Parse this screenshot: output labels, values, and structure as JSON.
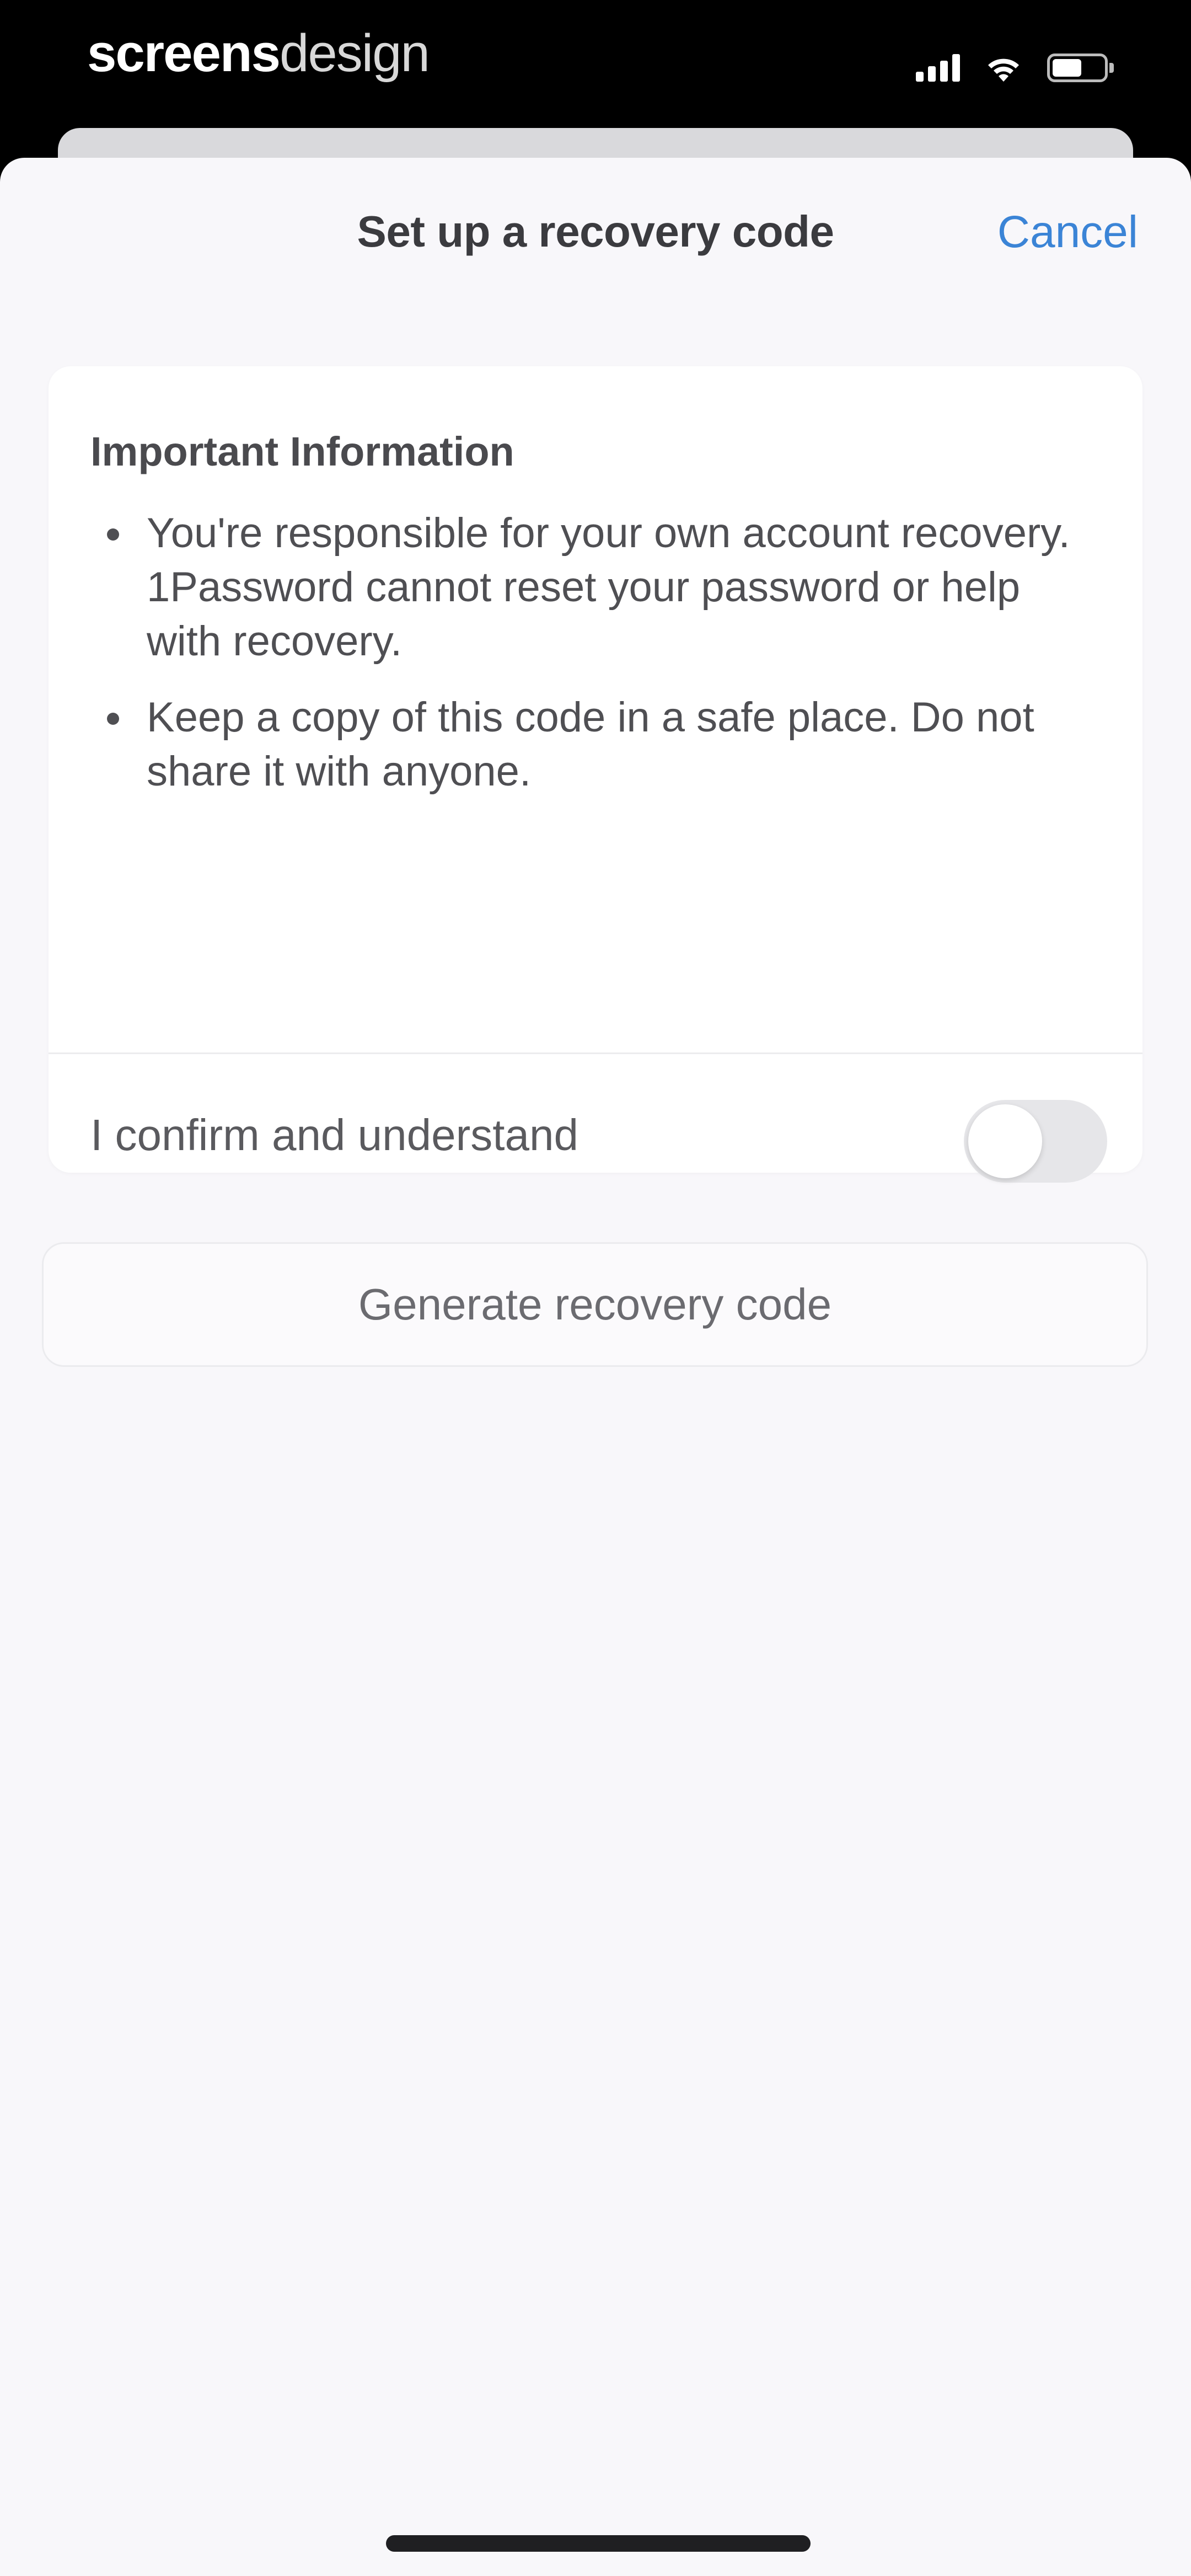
{
  "status_bar": {
    "brand_part1": "screens",
    "brand_part2": "design",
    "icons": [
      "signal-icon",
      "wifi-icon",
      "battery-icon"
    ]
  },
  "nav": {
    "title": "Set up a recovery code",
    "cancel_label": "Cancel"
  },
  "info_card": {
    "heading": "Important Information",
    "bullets": [
      "You're responsible for your own account recovery. 1Password cannot reset your password or help with recovery.",
      "Keep a copy of this code in a safe place. Do not share it with anyone."
    ],
    "confirm_label": "I confirm and understand",
    "confirm_toggle_on": false
  },
  "generate_button_label": "Generate recovery code",
  "colors": {
    "accent": "#3b84d6",
    "sheet_background": "#f8f7fa",
    "card_background": "#ffffff",
    "toggle_off": "#e6e6e9"
  }
}
